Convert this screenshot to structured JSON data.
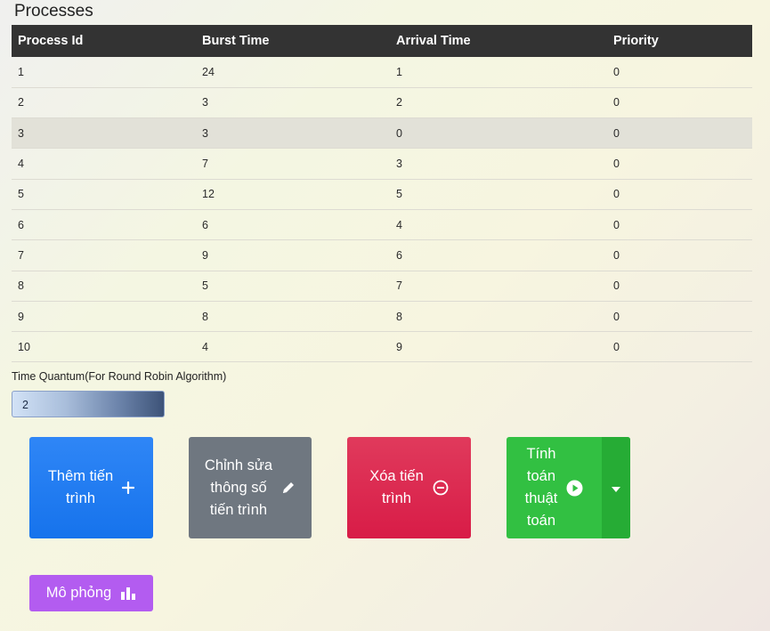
{
  "page": {
    "title": "Processes"
  },
  "table": {
    "headers": [
      "Process Id",
      "Burst Time",
      "Arrival Time",
      "Priority"
    ],
    "rows": [
      [
        "1",
        "24",
        "1",
        "0"
      ],
      [
        "2",
        "3",
        "2",
        "0"
      ],
      [
        "3",
        "3",
        "0",
        "0"
      ],
      [
        "4",
        "7",
        "3",
        "0"
      ],
      [
        "5",
        "12",
        "5",
        "0"
      ],
      [
        "6",
        "6",
        "4",
        "0"
      ],
      [
        "7",
        "9",
        "6",
        "0"
      ],
      [
        "8",
        "5",
        "7",
        "0"
      ],
      [
        "9",
        "8",
        "8",
        "0"
      ],
      [
        "10",
        "4",
        "9",
        "0"
      ]
    ],
    "highlighted_row": 3
  },
  "time_quantum": {
    "label": "Time Quantum(For Round Robin Algorithm)",
    "value": "2"
  },
  "buttons": {
    "add": {
      "label_line1": "Thêm tiến",
      "label_line2": "trình",
      "icon": "plus-icon"
    },
    "edit": {
      "label_line1": "Chỉnh sửa",
      "label_line2": "thông số",
      "label_line3": "tiến trình",
      "icon": "pencil-icon"
    },
    "delete": {
      "label_line1": "Xóa tiến",
      "label_line2": "trình",
      "icon": "minus-circle-icon"
    },
    "calculate": {
      "label_line1": "Tính",
      "label_line2": "toán",
      "label_line3": "thuật",
      "label_line4": "toán",
      "icon": "play-circle-icon",
      "dropdown_icon": "caret-down-icon"
    },
    "simulate": {
      "label": "Mô phỏng",
      "icon": "bar-chart-icon"
    }
  },
  "colors": {
    "header_bg": "#333333",
    "add": "#1f7af1",
    "edit": "#6f7780",
    "delete": "#dc2950",
    "calculate": "#32c042",
    "simulate": "#b35cf0"
  }
}
